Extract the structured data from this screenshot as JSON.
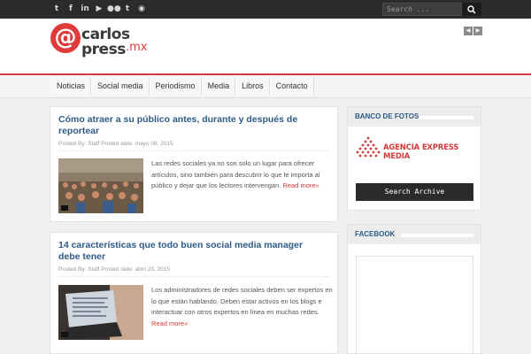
{
  "topbar": {
    "social_icons": [
      "twitter-icon",
      "facebook-icon",
      "linkedin-icon",
      "youtube-icon",
      "flickr-icon",
      "tumblr-icon",
      "rss-icon"
    ],
    "search_placeholder": "Search ..."
  },
  "logo": {
    "line1": "carlos",
    "line2": "press",
    "suffix": ".mx",
    "at": "@"
  },
  "nav": {
    "items": [
      "Noticias",
      "Social media",
      "Periodismo",
      "Media",
      "Libros",
      "Contacto"
    ]
  },
  "posts": [
    {
      "title": "Cómo atraer a su público antes, durante y después de reportear",
      "meta": "Posted By: Staff   Posted date: mayo 08, 2015",
      "excerpt": "Las redes sociales ya no son solo un lugar para ofrecer artículos, sino también para descubrir lo que le importa al público y dejar que los lectores intervengan.",
      "read_more": "Read more»"
    },
    {
      "title": "14 características que todo buen social media manager debe tener",
      "meta": "Posted By: Staff   Posted date: abril 23, 2015",
      "excerpt": "Los administradores de redes sociales deben ser expertos en lo que están hablando. Deben estar activos en los blogs e interactuar con otros expertos en línea en muchas redes.",
      "read_more": "Read more»"
    }
  ],
  "sidebar": {
    "banco": {
      "title": "BANCO DE FOTOS",
      "agency": "AGENCIA EXPRESS MEDIA",
      "button": "Search Archive"
    },
    "facebook": {
      "title": "FACEBOOK"
    }
  },
  "colors": {
    "accent": "#d33a3a",
    "link": "#2e5b86",
    "dark": "#2b2b2b"
  }
}
